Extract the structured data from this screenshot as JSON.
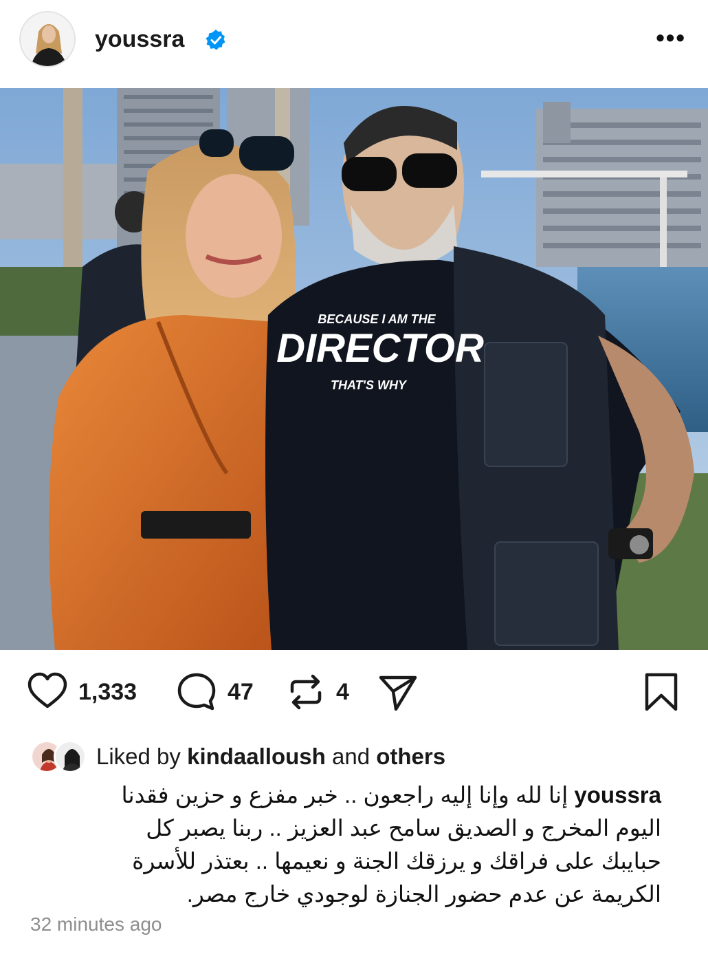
{
  "post": {
    "username": "youssra",
    "verified": true,
    "more_icon": "more-horizontal-icon",
    "photo": {
      "shirt_text_top": "BECAUSE I AM THE",
      "shirt_text_main": "DIRECTOR",
      "shirt_text_bottom": "THAT'S WHY"
    }
  },
  "actions": {
    "likes": "1,333",
    "comments": "47",
    "reposts": "4"
  },
  "liked_by": {
    "prefix": "Liked by",
    "user": "kindaalloush",
    "joiner": "and",
    "others": "others"
  },
  "caption": {
    "username": "youssra",
    "line1": "إنا لله وإنا إليه راجعون .. خبر مفزع و حزين فقدنا",
    "line2": "اليوم المخرج و الصديق سامح عبد العزيز .. ربنا يصبر كل",
    "line3": "حبايبك على فراقك و يرزقك الجنة و نعيمها .. بعتذر للأسرة",
    "line4": "الكريمة عن عدم حضور الجنازة لوجودي خارج مصر."
  },
  "timestamp": "32 minutes ago",
  "colors": {
    "verified": "#0095f6",
    "dress": "#d2661f",
    "sky": "#8fb3d9",
    "water": "#3f78a6"
  }
}
